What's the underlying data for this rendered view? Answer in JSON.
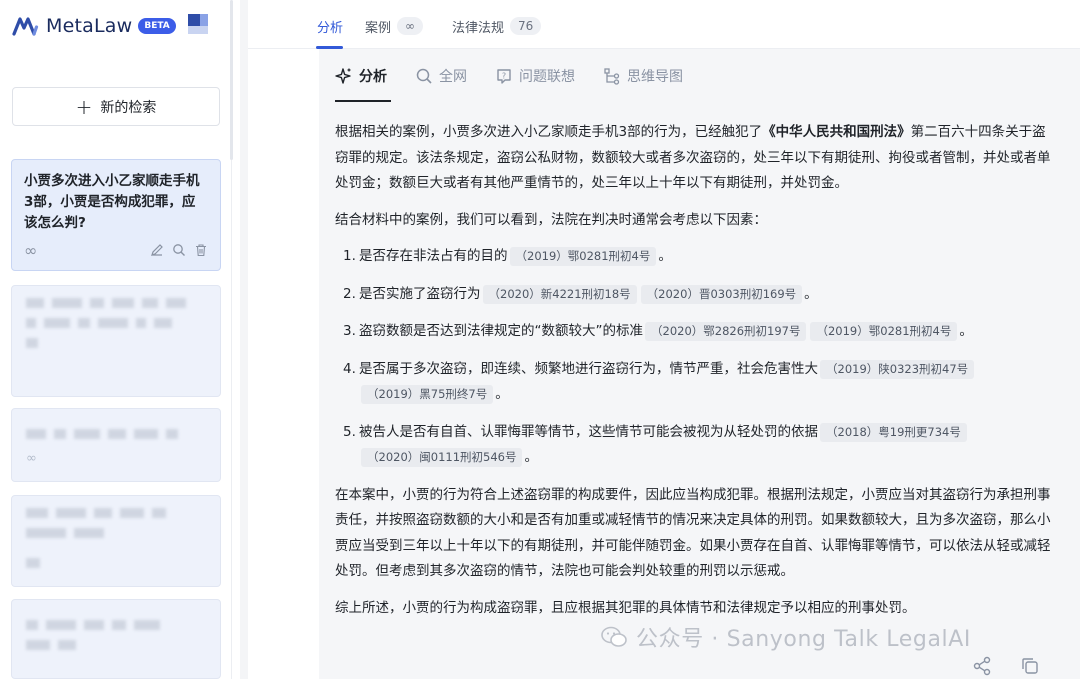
{
  "brand": {
    "name": "MetaLaw",
    "badge": "BETA"
  },
  "sidebar": {
    "new_search_label": "新的检索",
    "active_item": {
      "title": "小贾多次进入小乙家顺走手机3部，小贾是否构成犯罪，应该怎么判?"
    },
    "history_item_status_icon": "∞"
  },
  "tabs": [
    {
      "label": "分析",
      "count": ""
    },
    {
      "label": "案例",
      "count": "∞"
    },
    {
      "label": "法律法规",
      "count": "76"
    }
  ],
  "subtabs": [
    {
      "label": "分析",
      "icon": "sparkle-icon"
    },
    {
      "label": "全网",
      "icon": "search-icon"
    },
    {
      "label": "问题联想",
      "icon": "question-icon"
    },
    {
      "label": "思维导图",
      "icon": "mindmap-icon"
    }
  ],
  "answer": {
    "p1_a": "根据相关的案例，小贾多次进入小乙家顺走手机3部的行为，已经触犯了",
    "p1_law": "《中华人民共和国刑法》",
    "p1_b": "第二百六十四条关于盗窃罪的规定。该法条规定，盗窃公私财物，数额较大或者多次盗窃的，处三年以下有期徒刑、拘役或者管制，并处或者单处罚金；数额巨大或者有其他严重情节的，处三年以上十年以下有期徒刑，并处罚金。",
    "p2": "结合材料中的案例，我们可以看到，法院在判决时通常会考虑以下因素：",
    "items": [
      {
        "num": "1.",
        "text": "是否存在非法占有的目的",
        "cases": [
          "（2019）鄂0281刑初4号"
        ],
        "end": "。"
      },
      {
        "num": "2.",
        "text": "是否实施了盗窃行为",
        "cases": [
          "（2020）新4221刑初18号",
          "（2020）晋0303刑初169号"
        ],
        "end": "。"
      },
      {
        "num": "3.",
        "text": "盗窃数额是否达到法律规定的“数额较大”的标准",
        "cases": [
          "（2020）鄂2826刑初197号",
          "（2019）鄂0281刑初4号"
        ],
        "end": "。"
      },
      {
        "num": "4.",
        "text": "是否属于多次盗窃，即连续、频繁地进行盗窃行为，情节严重，社会危害性大",
        "cases": [
          "（2019）陕0323刑初47号",
          "（2019）黑75刑终7号"
        ],
        "end": "。"
      },
      {
        "num": "5.",
        "text": "被告人是否有自首、认罪悔罪等情节，这些情节可能会被视为从轻处罚的依据",
        "cases": [
          "（2018）粤19刑更734号",
          "（2020）闽0111刑初546号"
        ],
        "end": "。"
      }
    ],
    "p3": "在本案中，小贾的行为符合上述盗窃罪的构成要件，因此应当构成犯罪。根据刑法规定，小贾应当对其盗窃行为承担刑事责任，并按照盗窃数额的大小和是否有加重或减轻情节的情况来决定具体的刑罚。如果数额较大，且为多次盗窃，那么小贾应当受到三年以上十年以下的有期徒刑，并可能伴随罚金。如果小贾存在自首、认罪悔罪等情节，可以依法从轻或减轻处罚。但考虑到其多次盗窃的情节，法院也可能会判处较重的刑罚以示惩戒。",
    "p4": "综上所述，小贾的行为构成盗窃罪，且应根据其犯罪的具体情节和法律规定予以相应的刑事处罚。"
  },
  "watermark": "公众号 · Sanyong Talk LegalAI",
  "colors": {
    "accent": "#3259d8",
    "brand_dark": "#1a2b5e",
    "badge": "#3c5de8"
  }
}
